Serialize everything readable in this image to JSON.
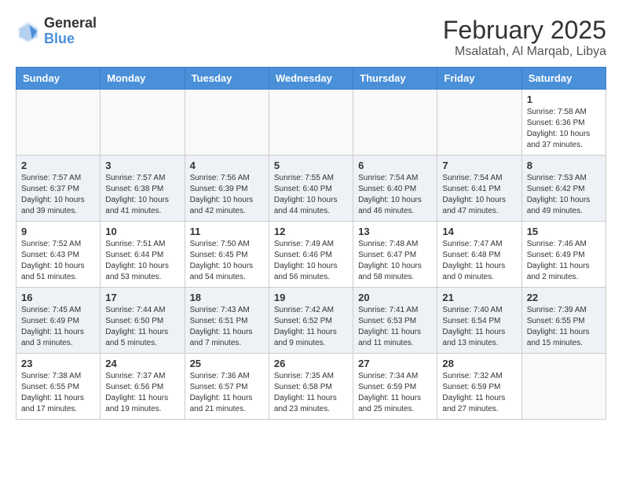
{
  "header": {
    "logo_general": "General",
    "logo_blue": "Blue",
    "month_year": "February 2025",
    "location": "Msalatah, Al Marqab, Libya"
  },
  "days_of_week": [
    "Sunday",
    "Monday",
    "Tuesday",
    "Wednesday",
    "Thursday",
    "Friday",
    "Saturday"
  ],
  "weeks": [
    [
      {
        "day": "",
        "info": ""
      },
      {
        "day": "",
        "info": ""
      },
      {
        "day": "",
        "info": ""
      },
      {
        "day": "",
        "info": ""
      },
      {
        "day": "",
        "info": ""
      },
      {
        "day": "",
        "info": ""
      },
      {
        "day": "1",
        "info": "Sunrise: 7:58 AM\nSunset: 6:36 PM\nDaylight: 10 hours and 37 minutes."
      }
    ],
    [
      {
        "day": "2",
        "info": "Sunrise: 7:57 AM\nSunset: 6:37 PM\nDaylight: 10 hours and 39 minutes."
      },
      {
        "day": "3",
        "info": "Sunrise: 7:57 AM\nSunset: 6:38 PM\nDaylight: 10 hours and 41 minutes."
      },
      {
        "day": "4",
        "info": "Sunrise: 7:56 AM\nSunset: 6:39 PM\nDaylight: 10 hours and 42 minutes."
      },
      {
        "day": "5",
        "info": "Sunrise: 7:55 AM\nSunset: 6:40 PM\nDaylight: 10 hours and 44 minutes."
      },
      {
        "day": "6",
        "info": "Sunrise: 7:54 AM\nSunset: 6:40 PM\nDaylight: 10 hours and 46 minutes."
      },
      {
        "day": "7",
        "info": "Sunrise: 7:54 AM\nSunset: 6:41 PM\nDaylight: 10 hours and 47 minutes."
      },
      {
        "day": "8",
        "info": "Sunrise: 7:53 AM\nSunset: 6:42 PM\nDaylight: 10 hours and 49 minutes."
      }
    ],
    [
      {
        "day": "9",
        "info": "Sunrise: 7:52 AM\nSunset: 6:43 PM\nDaylight: 10 hours and 51 minutes."
      },
      {
        "day": "10",
        "info": "Sunrise: 7:51 AM\nSunset: 6:44 PM\nDaylight: 10 hours and 53 minutes."
      },
      {
        "day": "11",
        "info": "Sunrise: 7:50 AM\nSunset: 6:45 PM\nDaylight: 10 hours and 54 minutes."
      },
      {
        "day": "12",
        "info": "Sunrise: 7:49 AM\nSunset: 6:46 PM\nDaylight: 10 hours and 56 minutes."
      },
      {
        "day": "13",
        "info": "Sunrise: 7:48 AM\nSunset: 6:47 PM\nDaylight: 10 hours and 58 minutes."
      },
      {
        "day": "14",
        "info": "Sunrise: 7:47 AM\nSunset: 6:48 PM\nDaylight: 11 hours and 0 minutes."
      },
      {
        "day": "15",
        "info": "Sunrise: 7:46 AM\nSunset: 6:49 PM\nDaylight: 11 hours and 2 minutes."
      }
    ],
    [
      {
        "day": "16",
        "info": "Sunrise: 7:45 AM\nSunset: 6:49 PM\nDaylight: 11 hours and 3 minutes."
      },
      {
        "day": "17",
        "info": "Sunrise: 7:44 AM\nSunset: 6:50 PM\nDaylight: 11 hours and 5 minutes."
      },
      {
        "day": "18",
        "info": "Sunrise: 7:43 AM\nSunset: 6:51 PM\nDaylight: 11 hours and 7 minutes."
      },
      {
        "day": "19",
        "info": "Sunrise: 7:42 AM\nSunset: 6:52 PM\nDaylight: 11 hours and 9 minutes."
      },
      {
        "day": "20",
        "info": "Sunrise: 7:41 AM\nSunset: 6:53 PM\nDaylight: 11 hours and 11 minutes."
      },
      {
        "day": "21",
        "info": "Sunrise: 7:40 AM\nSunset: 6:54 PM\nDaylight: 11 hours and 13 minutes."
      },
      {
        "day": "22",
        "info": "Sunrise: 7:39 AM\nSunset: 6:55 PM\nDaylight: 11 hours and 15 minutes."
      }
    ],
    [
      {
        "day": "23",
        "info": "Sunrise: 7:38 AM\nSunset: 6:55 PM\nDaylight: 11 hours and 17 minutes."
      },
      {
        "day": "24",
        "info": "Sunrise: 7:37 AM\nSunset: 6:56 PM\nDaylight: 11 hours and 19 minutes."
      },
      {
        "day": "25",
        "info": "Sunrise: 7:36 AM\nSunset: 6:57 PM\nDaylight: 11 hours and 21 minutes."
      },
      {
        "day": "26",
        "info": "Sunrise: 7:35 AM\nSunset: 6:58 PM\nDaylight: 11 hours and 23 minutes."
      },
      {
        "day": "27",
        "info": "Sunrise: 7:34 AM\nSunset: 6:59 PM\nDaylight: 11 hours and 25 minutes."
      },
      {
        "day": "28",
        "info": "Sunrise: 7:32 AM\nSunset: 6:59 PM\nDaylight: 11 hours and 27 minutes."
      },
      {
        "day": "",
        "info": ""
      }
    ]
  ]
}
